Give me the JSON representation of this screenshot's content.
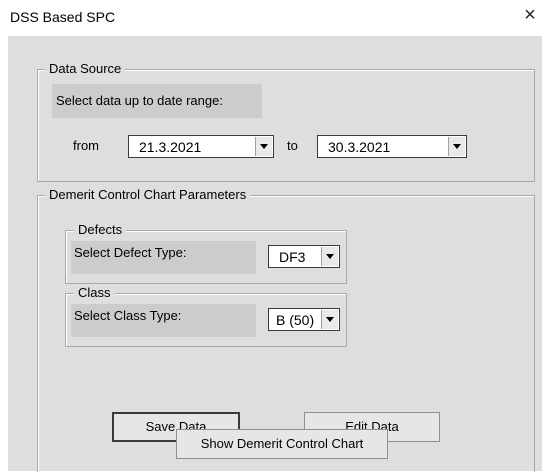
{
  "window": {
    "title": "DSS Based SPC",
    "close_glyph": "×"
  },
  "data_source": {
    "legend": "Data Source",
    "prompt": "Select data up to date range:",
    "from_label": "from",
    "from_value": "21.3.2021",
    "to_label": "to",
    "to_value": "30.3.2021"
  },
  "params": {
    "legend": "Demerit Control Chart Parameters",
    "defects": {
      "legend": "Defects",
      "prompt": "Select Defect Type:",
      "value": "DF3"
    },
    "class": {
      "legend": "Class",
      "prompt": "Select Class Type:",
      "value": "B (50)"
    }
  },
  "buttons": {
    "save": "Save Data",
    "edit": "Edit Data",
    "show_chart": "Show Demerit Control Chart"
  },
  "icons": {
    "close": "close-icon",
    "dropdown": "chevron-down-icon"
  }
}
